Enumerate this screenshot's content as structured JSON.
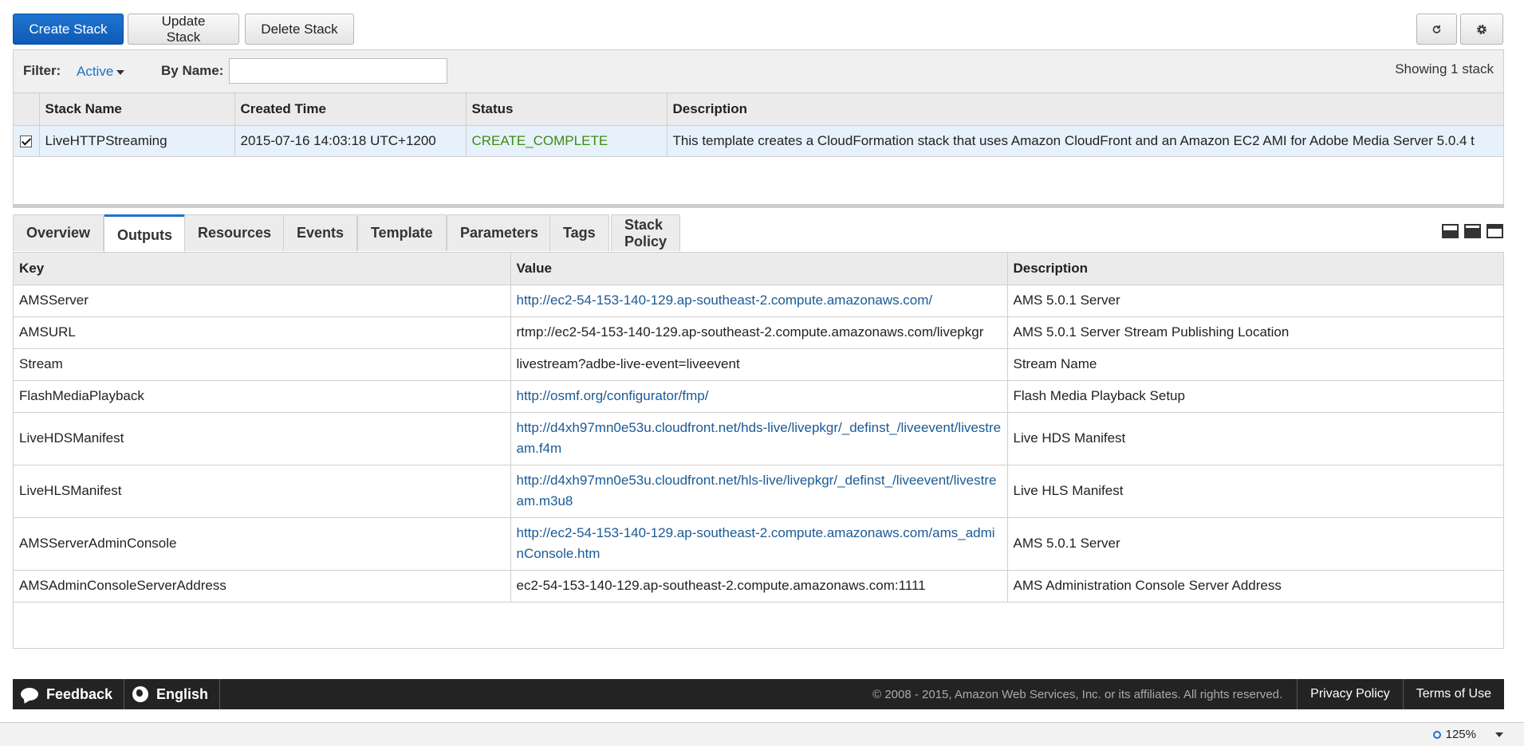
{
  "toolbar": {
    "create_label": "Create Stack",
    "update_label": "Update Stack",
    "delete_label": "Delete Stack",
    "refresh_icon": "refresh-icon",
    "settings_icon": "gear-icon"
  },
  "filter": {
    "label": "Filter:",
    "active": "Active",
    "by_name_label": "By Name:",
    "by_name_value": "",
    "showing": "Showing 1 stack"
  },
  "stacks": {
    "columns": [
      "Stack Name",
      "Created Time",
      "Status",
      "Description"
    ],
    "rows": [
      {
        "selected": true,
        "name": "LiveHTTPStreaming",
        "created": "2015-07-16 14:03:18 UTC+1200",
        "status": "CREATE_COMPLETE",
        "description": "This template creates a CloudFormation stack that uses Amazon CloudFront and an Amazon EC2 AMI for Adobe Media Server 5.0.4 t"
      }
    ]
  },
  "tabs": [
    "Overview",
    "Outputs",
    "Resources",
    "Events",
    "Template",
    "Parameters",
    "Tags",
    "Stack Policy"
  ],
  "active_tab": "Outputs",
  "outputs": {
    "columns": [
      "Key",
      "Value",
      "Description"
    ],
    "rows": [
      {
        "key": "AMSServer",
        "value": "http://ec2-54-153-140-129.ap-southeast-2.compute.amazonaws.com/",
        "link": true,
        "description": "AMS 5.0.1 Server"
      },
      {
        "key": "AMSURL",
        "value": "rtmp://ec2-54-153-140-129.ap-southeast-2.compute.amazonaws.com/livepkgr",
        "link": false,
        "description": "AMS 5.0.1 Server Stream Publishing Location"
      },
      {
        "key": "Stream",
        "value": "livestream?adbe-live-event=liveevent",
        "link": false,
        "description": "Stream Name"
      },
      {
        "key": "FlashMediaPlayback",
        "value": "http://osmf.org/configurator/fmp/",
        "link": true,
        "description": "Flash Media Playback Setup"
      },
      {
        "key": "LiveHDSManifest",
        "value": "http://d4xh97mn0e53u.cloudfront.net/hds-live/livepkgr/_definst_/liveevent/livestream.f4m",
        "link": true,
        "description": "Live HDS Manifest"
      },
      {
        "key": "LiveHLSManifest",
        "value": "http://d4xh97mn0e53u.cloudfront.net/hls-live/livepkgr/_definst_/liveevent/livestream.m3u8",
        "link": true,
        "description": "Live HLS Manifest"
      },
      {
        "key": "AMSServerAdminConsole",
        "value": "http://ec2-54-153-140-129.ap-southeast-2.compute.amazonaws.com/ams_adminConsole.htm",
        "link": true,
        "description": "AMS 5.0.1 Server"
      },
      {
        "key": "AMSAdminConsoleServerAddress",
        "value": "ec2-54-153-140-129.ap-southeast-2.compute.amazonaws.com:1111",
        "link": false,
        "description": "AMS Administration Console Server Address"
      }
    ]
  },
  "footer": {
    "feedback": "Feedback",
    "language": "English",
    "copyright": "© 2008 - 2015, Amazon Web Services, Inc. or its affiliates. All rights reserved.",
    "privacy": "Privacy Policy",
    "terms": "Terms of Use"
  },
  "statusbar": {
    "zoom": "125%"
  },
  "colors": {
    "primary": "#0e5bb5",
    "link": "#1a5a96",
    "status_ok": "#3c8c11",
    "footer_bg": "#232323"
  }
}
